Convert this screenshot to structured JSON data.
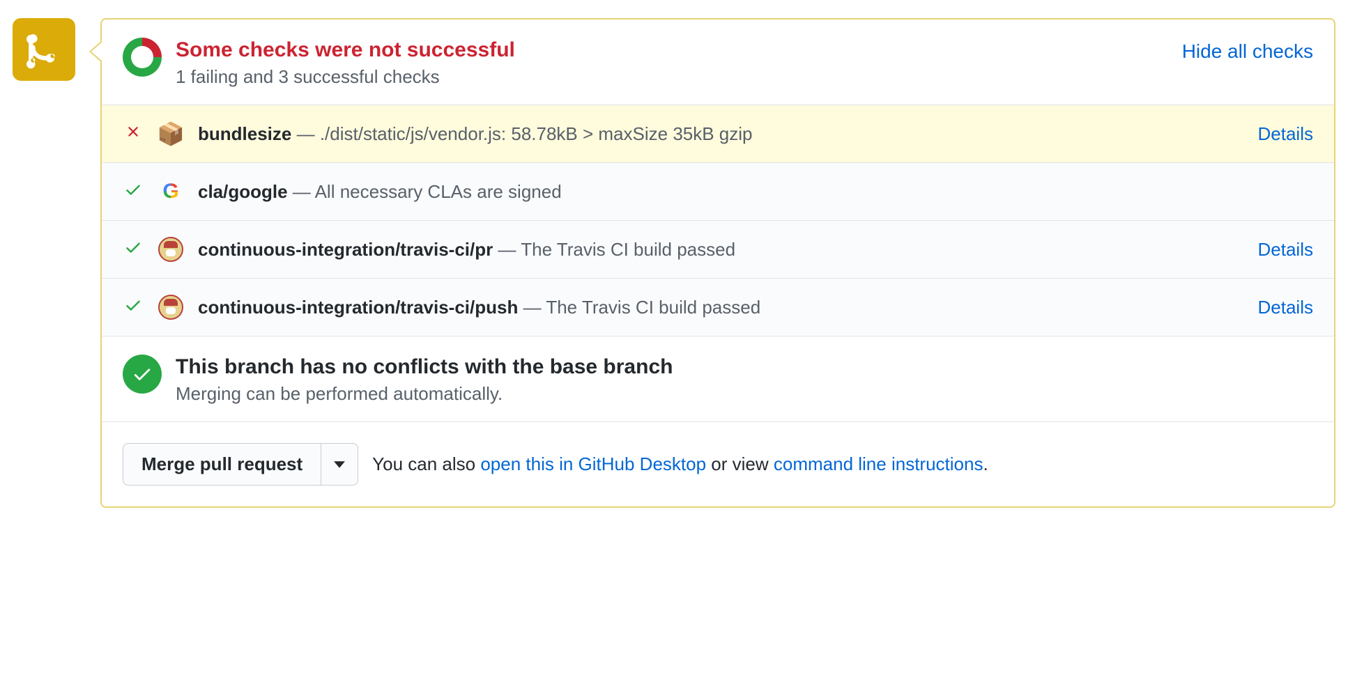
{
  "summary": {
    "title": "Some checks were not successful",
    "subtitle": "1 failing and 3 successful checks",
    "hide_label": "Hide all checks"
  },
  "checks": [
    {
      "status": "fail",
      "icon": "package",
      "name": "bundlesize",
      "desc": "./dist/static/js/vendor.js: 58.78kB > maxSize 35kB gzip",
      "details_label": "Details",
      "has_details": true
    },
    {
      "status": "pass",
      "icon": "google",
      "name": "cla/google",
      "desc": "All necessary CLAs are signed",
      "details_label": "",
      "has_details": false
    },
    {
      "status": "pass",
      "icon": "travis",
      "name": "continuous-integration/travis-ci/pr",
      "desc": "The Travis CI build passed",
      "details_label": "Details",
      "has_details": true
    },
    {
      "status": "pass",
      "icon": "travis",
      "name": "continuous-integration/travis-ci/push",
      "desc": "The Travis CI build passed",
      "details_label": "Details",
      "has_details": true
    }
  ],
  "merge": {
    "title": "This branch has no conflicts with the base branch",
    "subtitle": "Merging can be performed automatically."
  },
  "footer": {
    "merge_button": "Merge pull request",
    "helper_prefix": "You can also ",
    "open_desktop": "open this in GitHub Desktop",
    "helper_mid": " or view ",
    "cmd_instructions": "command line instructions",
    "helper_suffix": "."
  },
  "sep": " — "
}
